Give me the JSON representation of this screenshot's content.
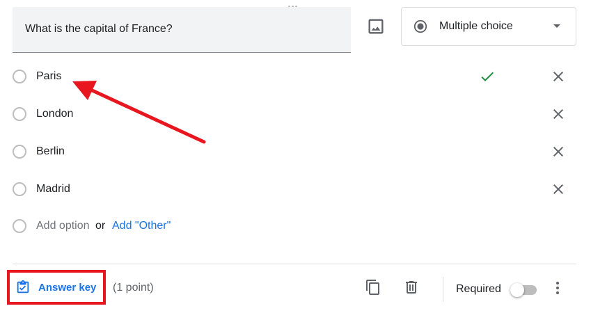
{
  "question": {
    "text": "What is the capital of France?"
  },
  "question_type": {
    "selected": "Multiple choice",
    "icon": "radio-button-checked-icon"
  },
  "options": [
    {
      "label": "Paris",
      "correct": true
    },
    {
      "label": "London",
      "correct": false
    },
    {
      "label": "Berlin",
      "correct": false
    },
    {
      "label": "Madrid",
      "correct": false
    }
  ],
  "add_option": {
    "placeholder": "Add option",
    "or": "or",
    "add_other": "Add \"Other\""
  },
  "footer": {
    "answer_key_label": "Answer key",
    "points": "(1 point)",
    "required_label": "Required",
    "required_on": false
  },
  "colors": {
    "accent": "#1a73e8",
    "correct_check": "#1e8e3e",
    "annotation": "#e8171f"
  }
}
